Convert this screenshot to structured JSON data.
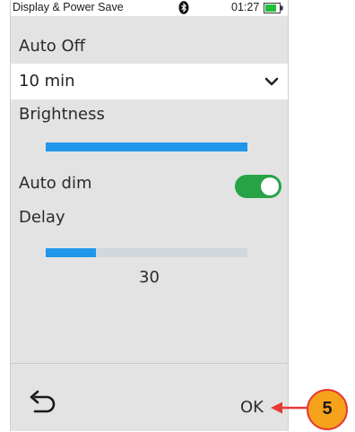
{
  "status_bar": {
    "title": "Display & Power Save",
    "bluetooth_icon": "bluetooth-icon",
    "time": "01:27",
    "battery_icon": "battery-icon",
    "battery_color": "#1fbf3a"
  },
  "auto_off": {
    "label": "Auto Off",
    "selected_value": "10 min",
    "chevron_icon": "chevron-down-icon"
  },
  "brightness": {
    "label": "Brightness",
    "level_percent": 100
  },
  "auto_dim": {
    "label": "Auto dim",
    "enabled": true,
    "toggle_color": "#27a346"
  },
  "delay": {
    "label": "Delay",
    "value": "30",
    "level_percent": 25
  },
  "bottom_bar": {
    "back_icon": "back-arrow-icon",
    "ok_label": "OK"
  },
  "callout": {
    "number": "5",
    "accent_color": "#e53935",
    "badge_color": "#f7a21b"
  },
  "colors": {
    "slider_fill": "#2196ea",
    "slider_track": "#d0d8dc",
    "screen_background": "#e3e3e3"
  }
}
